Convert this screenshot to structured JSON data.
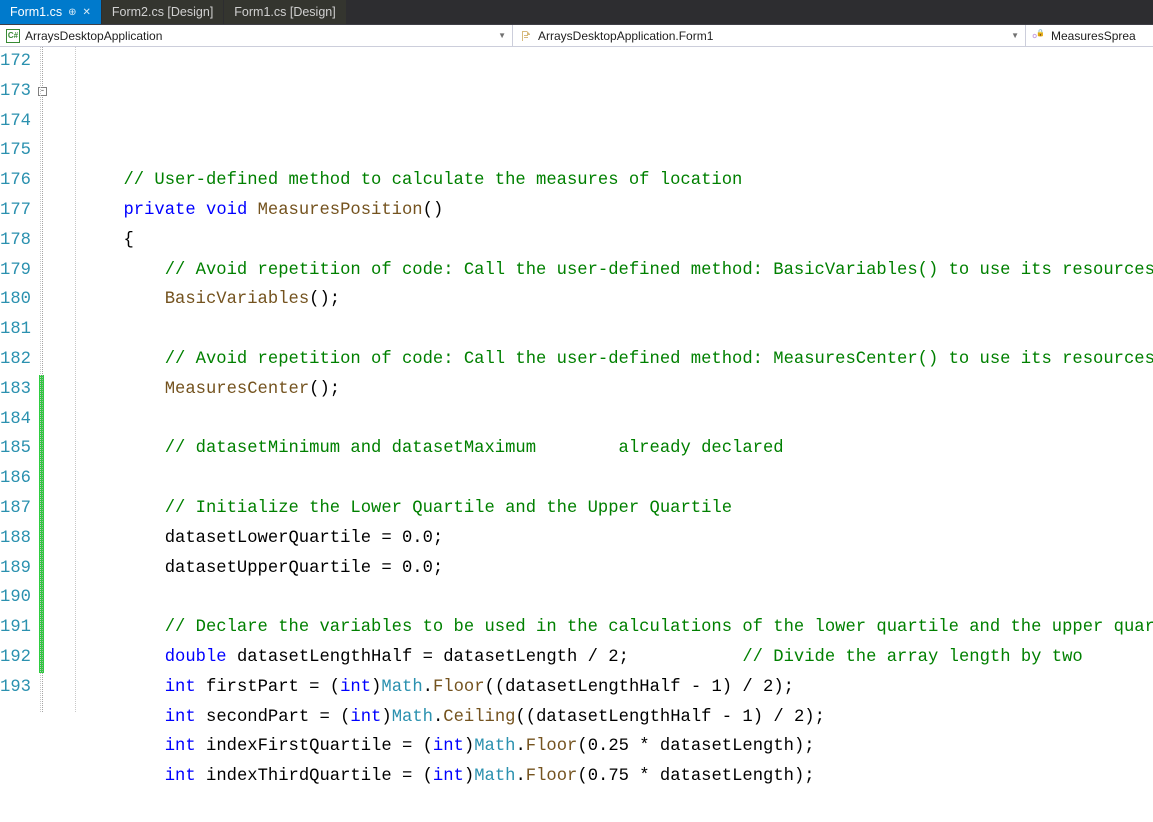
{
  "tabs": [
    {
      "label": "Form1.cs",
      "active": true,
      "pinned": true,
      "closable": true
    },
    {
      "label": "Form2.cs [Design]",
      "active": false
    },
    {
      "label": "Form1.cs [Design]",
      "active": false
    }
  ],
  "nav": {
    "scope": "ArraysDesktopApplication",
    "class": "ArraysDesktopApplication.Form1",
    "member": "MeasuresSprea"
  },
  "first_line": 172,
  "outline_collapse_on_line": 173,
  "change_marks": [
    {
      "from": 183,
      "to": 192,
      "kind": "green"
    }
  ],
  "lines": [
    [
      [
        "        ",
        ""
      ],
      [
        "// User-defined method to calculate the measures of location",
        "c-comment"
      ]
    ],
    [
      [
        "        ",
        ""
      ],
      [
        "private",
        "c-key"
      ],
      [
        " ",
        ""
      ],
      [
        "void",
        "c-key"
      ],
      [
        " ",
        ""
      ],
      [
        "MeasuresPosition",
        "c-method"
      ],
      [
        "()",
        ""
      ]
    ],
    [
      [
        "        {",
        ""
      ]
    ],
    [
      [
        "            ",
        ""
      ],
      [
        "// Avoid repetition of code: Call the user-defined method: BasicVariables() to use its resources",
        "c-comment"
      ]
    ],
    [
      [
        "            ",
        ""
      ],
      [
        "BasicVariables",
        "c-method"
      ],
      [
        "();",
        ""
      ]
    ],
    [
      [
        "",
        ""
      ]
    ],
    [
      [
        "            ",
        ""
      ],
      [
        "// Avoid repetition of code: Call the user-defined method: MeasuresCenter() to use its resources",
        "c-comment"
      ]
    ],
    [
      [
        "            ",
        ""
      ],
      [
        "MeasuresCenter",
        "c-method"
      ],
      [
        "();",
        ""
      ]
    ],
    [
      [
        "",
        ""
      ]
    ],
    [
      [
        "            ",
        ""
      ],
      [
        "// datasetMinimum and datasetMaximum        already declared",
        "c-comment"
      ]
    ],
    [
      [
        "",
        ""
      ]
    ],
    [
      [
        "            ",
        ""
      ],
      [
        "// Initialize the Lower Quartile and the Upper Quartile",
        "c-comment"
      ]
    ],
    [
      [
        "            datasetLowerQuartile = 0.0;",
        ""
      ]
    ],
    [
      [
        "            datasetUpperQuartile = 0.0;",
        ""
      ]
    ],
    [
      [
        "",
        ""
      ]
    ],
    [
      [
        "            ",
        ""
      ],
      [
        "// Declare the variables to be used in the calculations of the lower quartile and the upper quartile",
        "c-comment"
      ]
    ],
    [
      [
        "            ",
        ""
      ],
      [
        "double",
        "c-key"
      ],
      [
        " datasetLengthHalf = datasetLength / 2;           ",
        ""
      ],
      [
        "// Divide the array length by two",
        "c-comment"
      ]
    ],
    [
      [
        "            ",
        ""
      ],
      [
        "int",
        "c-key"
      ],
      [
        " firstPart = (",
        ""
      ],
      [
        "int",
        "c-key"
      ],
      [
        ")",
        ""
      ],
      [
        "Math",
        "c-type"
      ],
      [
        ".",
        ""
      ],
      [
        "Floor",
        "c-method"
      ],
      [
        "((datasetLengthHalf - 1) / 2);",
        ""
      ]
    ],
    [
      [
        "            ",
        ""
      ],
      [
        "int",
        "c-key"
      ],
      [
        " secondPart = (",
        ""
      ],
      [
        "int",
        "c-key"
      ],
      [
        ")",
        ""
      ],
      [
        "Math",
        "c-type"
      ],
      [
        ".",
        ""
      ],
      [
        "Ceiling",
        "c-method"
      ],
      [
        "((datasetLengthHalf - 1) / 2);",
        ""
      ]
    ],
    [
      [
        "            ",
        ""
      ],
      [
        "int",
        "c-key"
      ],
      [
        " indexFirstQuartile = (",
        ""
      ],
      [
        "int",
        "c-key"
      ],
      [
        ")",
        ""
      ],
      [
        "Math",
        "c-type"
      ],
      [
        ".",
        ""
      ],
      [
        "Floor",
        "c-method"
      ],
      [
        "(0.25 * datasetLength);",
        ""
      ]
    ],
    [
      [
        "            ",
        ""
      ],
      [
        "int",
        "c-key"
      ],
      [
        " indexThirdQuartile = (",
        ""
      ],
      [
        "int",
        "c-key"
      ],
      [
        ")",
        ""
      ],
      [
        "Math",
        "c-type"
      ],
      [
        ".",
        ""
      ],
      [
        "Floor",
        "c-method"
      ],
      [
        "(0.75 * datasetLength);",
        ""
      ]
    ],
    [
      [
        "",
        ""
      ]
    ]
  ]
}
